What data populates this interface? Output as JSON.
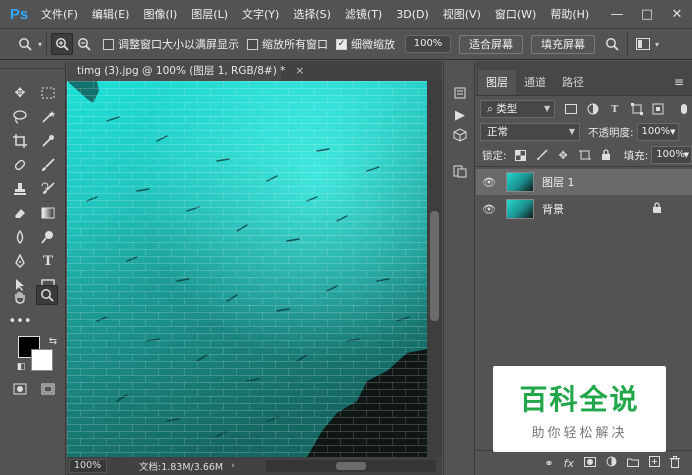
{
  "app": {
    "logo": "Ps"
  },
  "menu": [
    "文件(F)",
    "编辑(E)",
    "图像(I)",
    "图层(L)",
    "文字(Y)",
    "选择(S)",
    "滤镜(T)",
    "3D(D)",
    "视图(V)",
    "窗口(W)",
    "帮助(H)"
  ],
  "window_controls": {
    "minimize": "—",
    "maximize": "□",
    "close": "✕"
  },
  "options": {
    "resize_windows_label": "调整窗口大小以满屏显示",
    "resize_windows_checked": false,
    "zoom_all_label": "缩放所有窗口",
    "zoom_all_checked": false,
    "scrubby_zoom_label": "细微缩放",
    "scrubby_zoom_checked": true,
    "zoom_value": "100%",
    "fit_screen": "适合屏幕",
    "fill_screen": "填充屏幕"
  },
  "document": {
    "tab_title": "timg (3).jpg @ 100% (图层 1, RGB/8#) *",
    "tab_close": "×",
    "zoom": "100%",
    "doc_info": "文档:1.83M/3.66M"
  },
  "layers_panel": {
    "tabs": [
      "图层",
      "通道",
      "路径"
    ],
    "active_tab": 0,
    "filter_kind": "类型",
    "blend_mode": "正常",
    "opacity_label": "不透明度:",
    "opacity_value": "100%",
    "lock_label": "锁定:",
    "fill_label": "填充:",
    "fill_value": "100%",
    "layers": [
      {
        "name": "图层 1",
        "selected": true,
        "locked": false
      },
      {
        "name": "背景",
        "selected": false,
        "locked": true
      }
    ]
  },
  "watermark": {
    "title": "百科全说",
    "subtitle": "助你轻松解决"
  },
  "colors": {
    "accent_logo": "#31a8ff",
    "watermark_green": "#21a649"
  }
}
